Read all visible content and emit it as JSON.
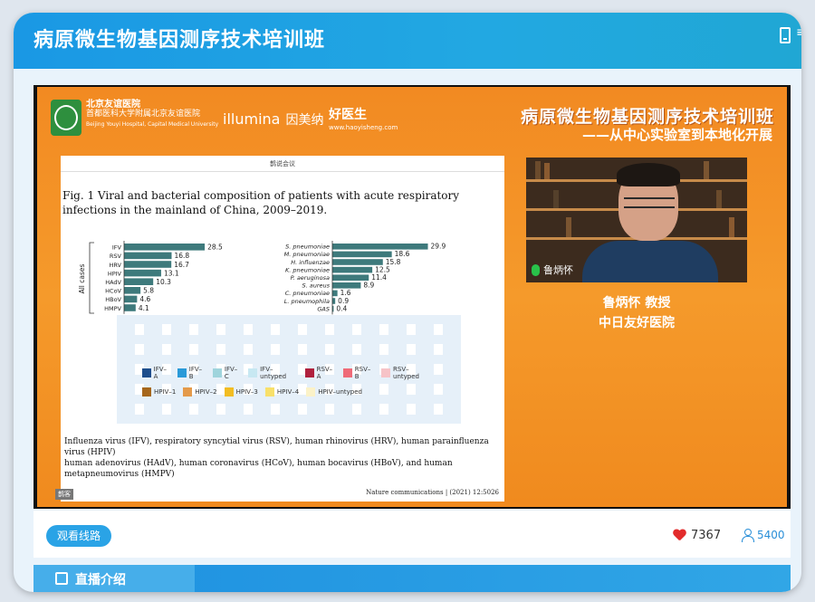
{
  "window": {
    "title": "病原微生物基因测序技术培训班"
  },
  "slide": {
    "title": "病原微生物基因测序技术培训班",
    "subtitle": "——从中心实验室到本地化开展",
    "logos": {
      "hospital_line1": "北京友谊医院",
      "hospital_line2": "首都医科大学附属北京友谊医院",
      "hospital_line3": "Beijing Youyi Hospital, Capital Medical University",
      "illumina": "illumina",
      "illumina_cn": "因美纳",
      "partner": "好医生",
      "partner_url": "www.haoyisheng.com"
    },
    "paper": {
      "topic": "鹊说会议",
      "figure_caption": "Fig. 1 Viral and bacterial composition of patients with acute respiratory infections in the mainland of China, 2009–2019.",
      "body_line1": "Influenza virus (IFV), respiratory syncytial virus (RSV), human rhinovirus (HRV), human parainfluenza virus (HPIV)",
      "body_line2": "human adenovirus (HAdV), human coronavirus (HCoV), human bocavirus (HBoV), and human metapneumovirus (HMPV)",
      "citation": "Nature communications | (2021) 12:5026",
      "footer_tag": "鹊客"
    },
    "presenter": {
      "video_name": "鲁炳怀",
      "name_title": "鲁炳怀 教授",
      "org": "中日友好医院"
    }
  },
  "controls": {
    "route_button": "观看线路",
    "likes": "7367",
    "viewers": "5400"
  },
  "tabs": {
    "intro": "直播介绍"
  },
  "colors": {
    "brand_blue": "#1a98e4",
    "slide_orange": "#f28a22",
    "bar_teal": "#3e7a7c"
  },
  "chart_data": [
    {
      "type": "bar",
      "orientation": "horizontal",
      "ylabel": "All cases",
      "categories": [
        "IFV",
        "RSV",
        "HRV",
        "HPIV",
        "HAdV",
        "HCoV",
        "HBoV",
        "HMPV"
      ],
      "values": [
        28.5,
        16.8,
        16.7,
        13.1,
        10.3,
        5.8,
        4.6,
        4.1
      ],
      "xlim": [
        0,
        32
      ]
    },
    {
      "type": "bar",
      "orientation": "horizontal",
      "categories": [
        "S. pneumoniae",
        "M. pneumoniae",
        "H. influenzae",
        "K. pneumoniae",
        "P. aeruginosa",
        "S. aureus",
        "C. pneumoniae",
        "L. pneumophila",
        "GAS"
      ],
      "values": [
        29.9,
        18.6,
        15.8,
        12.5,
        11.4,
        8.9,
        1.6,
        0.9,
        0.4
      ],
      "xlim": [
        0,
        34
      ]
    }
  ],
  "legend": {
    "row1": [
      {
        "label": "IFV–A",
        "color": "#1e4e8c"
      },
      {
        "label": "IFV–B",
        "color": "#2a9ad8"
      },
      {
        "label": "IFV–C",
        "color": "#9fd4dc"
      },
      {
        "label": "IFV–untyped",
        "color": "#c7e8f2"
      },
      {
        "label": "RSV–A",
        "color": "#b0213d"
      },
      {
        "label": "RSV–B",
        "color": "#ef6b78"
      },
      {
        "label": "RSV–untyped",
        "color": "#f6c3c7"
      }
    ],
    "row2": [
      {
        "label": "HPIV–1",
        "color": "#a6671b"
      },
      {
        "label": "HPIV–2",
        "color": "#e49a4a"
      },
      {
        "label": "HPIV–3",
        "color": "#f2bd22"
      },
      {
        "label": "HPIV–4",
        "color": "#f8e06a"
      },
      {
        "label": "HPIV–untyped",
        "color": "#fbf2c8"
      }
    ]
  }
}
